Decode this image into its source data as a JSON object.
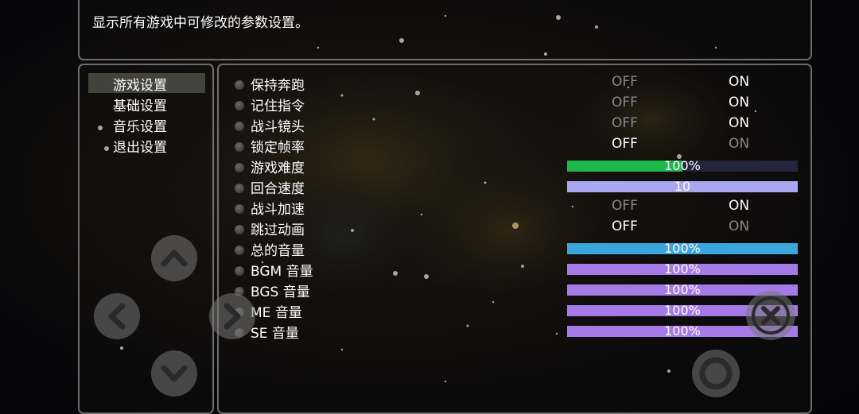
{
  "help": {
    "text": "显示所有游戏中可修改的参数设置。"
  },
  "categories": [
    {
      "label": "游戏设置",
      "selected": true
    },
    {
      "label": "基础设置",
      "selected": false
    },
    {
      "label": "音乐设置",
      "selected": false
    },
    {
      "label": "退出设置",
      "selected": false
    }
  ],
  "options": [
    {
      "label": "保持奔跑",
      "type": "toggle",
      "off": "OFF",
      "on": "ON",
      "value": "ON"
    },
    {
      "label": "记住指令",
      "type": "toggle",
      "off": "OFF",
      "on": "ON",
      "value": "ON"
    },
    {
      "label": "战斗镜头",
      "type": "toggle",
      "off": "OFF",
      "on": "ON",
      "value": "ON"
    },
    {
      "label": "锁定帧率",
      "type": "toggle",
      "off": "OFF",
      "on": "ON",
      "value": "OFF"
    },
    {
      "label": "游戏难度",
      "type": "gauge",
      "text": "100%",
      "fill": 0.5,
      "color": "#1fb84a"
    },
    {
      "label": "回合速度",
      "type": "gauge",
      "text": "10",
      "fill": 1.0,
      "color": "#a9a7f0"
    },
    {
      "label": "战斗加速",
      "type": "toggle",
      "off": "OFF",
      "on": "ON",
      "value": "ON"
    },
    {
      "label": "跳过动画",
      "type": "toggle",
      "off": "OFF",
      "on": "ON",
      "value": "OFF"
    },
    {
      "label": "总的音量",
      "type": "gauge",
      "text": "100%",
      "fill": 1.0,
      "color": "#3aa6dd"
    },
    {
      "label": "BGM 音量",
      "type": "gauge",
      "text": "100%",
      "fill": 1.0,
      "color": "#a579e6"
    },
    {
      "label": "BGS 音量",
      "type": "gauge",
      "text": "100%",
      "fill": 1.0,
      "color": "#a579e6"
    },
    {
      "label": "ME 音量",
      "type": "gauge",
      "text": "100%",
      "fill": 1.0,
      "color": "#a579e6"
    },
    {
      "label": "SE 音量",
      "type": "gauge",
      "text": "100%",
      "fill": 1.0,
      "color": "#a579e6"
    }
  ],
  "controls": {
    "up": "chevron-up-icon",
    "down": "chevron-down-icon",
    "left": "chevron-left-icon",
    "right": "chevron-right-icon",
    "cancel": "close-icon",
    "confirm": "ring-icon"
  }
}
